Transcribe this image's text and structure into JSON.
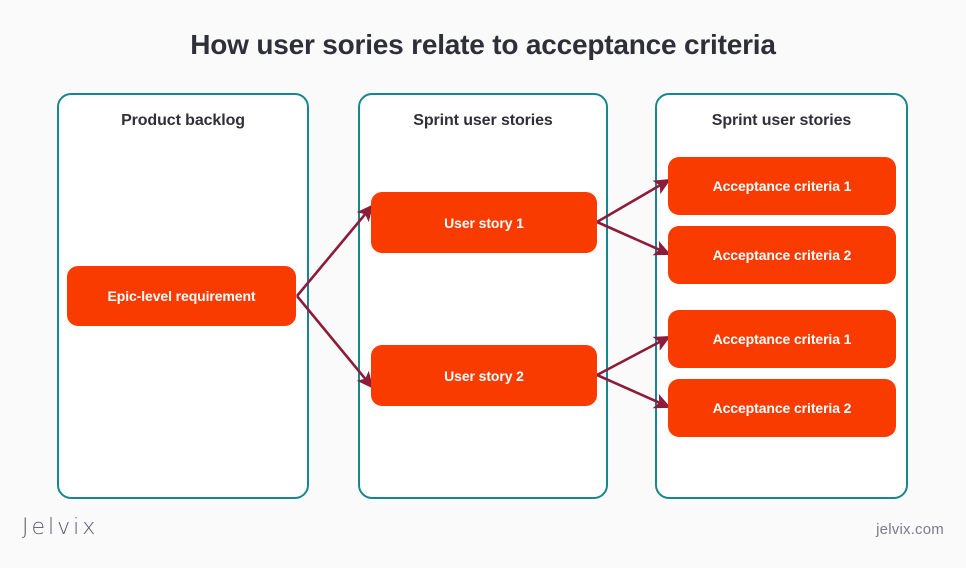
{
  "title": "How user sories relate to acceptance criteria",
  "colors": {
    "background": "#fafafa",
    "column_border": "#17868e",
    "card_fill": "#f93b00",
    "card_text": "#ffffff",
    "connector": "#8c1c3a",
    "title_text": "#2f2f38"
  },
  "columns": [
    {
      "title": "Product backlog",
      "cards": [
        {
          "label": "Epic-level requirement"
        }
      ]
    },
    {
      "title": "Sprint user stories",
      "cards": [
        {
          "label": "User story 1"
        },
        {
          "label": "User story 2"
        }
      ]
    },
    {
      "title": "Sprint user stories",
      "cards": [
        {
          "label": "Acceptance criteria 1"
        },
        {
          "label": "Acceptance criteria 2"
        },
        {
          "label": "Acceptance criteria 1"
        },
        {
          "label": "Acceptance criteria 2"
        }
      ]
    }
  ],
  "connections": [
    {
      "from": "Epic-level requirement",
      "to": "User story 1"
    },
    {
      "from": "Epic-level requirement",
      "to": "User story 2"
    },
    {
      "from": "User story 1",
      "to": "Acceptance criteria 1"
    },
    {
      "from": "User story 1",
      "to": "Acceptance criteria 2"
    },
    {
      "from": "User story 2",
      "to": "Acceptance criteria 1"
    },
    {
      "from": "User story 2",
      "to": "Acceptance criteria 2"
    }
  ],
  "footer": {
    "logo": "Jelvix",
    "url": "jelvix.com"
  }
}
